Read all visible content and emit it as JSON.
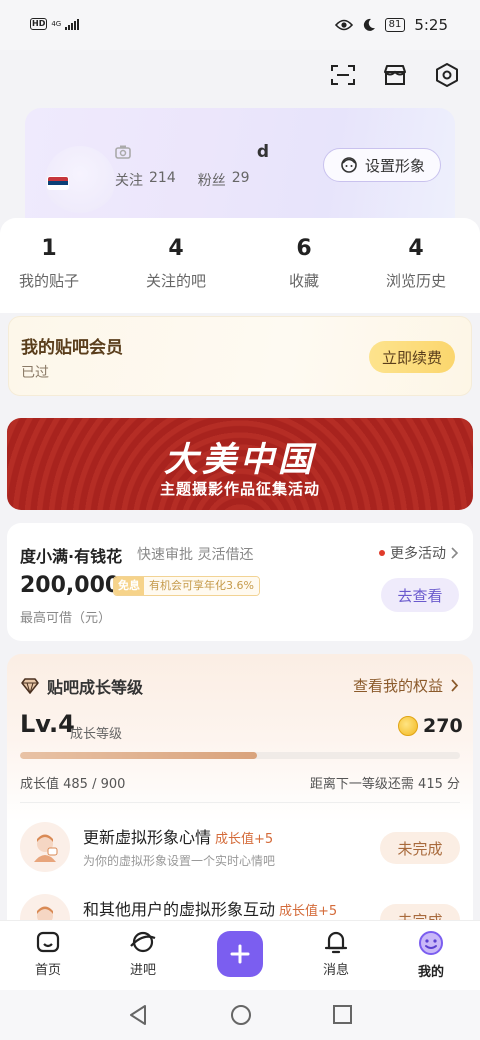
{
  "status_bar": {
    "network_badge": "HD",
    "network_type": "4G",
    "battery": "81",
    "time": "5:25"
  },
  "top_icons": [
    "scan-icon",
    "shop-icon",
    "settings-hexagon-icon"
  ],
  "profile": {
    "username_visible": "d",
    "follow_label": "关注",
    "follow_count": "214",
    "fans_label": "粉丝",
    "fans_count": "29",
    "set_avatar_label": "设置形象"
  },
  "stats": [
    {
      "value": "1",
      "label": "我的贴子"
    },
    {
      "value": "4",
      "label": "关注的吧"
    },
    {
      "value": "6",
      "label": "收藏"
    },
    {
      "value": "4",
      "label": "浏览历史"
    }
  ],
  "membership": {
    "title": "我的贴吧会员",
    "status": "已过",
    "renew_label": "立即续费"
  },
  "banner": {
    "title": "大美中国",
    "subtitle": "主题摄影作品征集活动"
  },
  "loan": {
    "name": "度小满·有钱花",
    "slogan": "快速审批 灵活借还",
    "more_label": "更多活动",
    "amount": "200,000",
    "badge_tag": "免息",
    "badge_text": "有机会可享年化3.6%",
    "limit_label": "最高可借（元）",
    "check_label": "去查看"
  },
  "growth": {
    "title": "贴吧成长等级",
    "rights_label": "查看我的权益",
    "level": "Lv.4",
    "level_label": "成长等级",
    "coins": "270",
    "progress": 0.539,
    "value_text": "成长值 485 / 900",
    "next_text": "距离下一等级还需 415 分",
    "tasks": [
      {
        "title": "更新虚拟形象心情",
        "reward": "成长值+5",
        "desc": "为你的虚拟形象设置一个实时心情吧",
        "button": "未完成"
      },
      {
        "title": "和其他用户的虚拟形象互动",
        "reward": "成长值+5",
        "desc": "",
        "button": "未完成"
      }
    ]
  },
  "bottom_nav": [
    {
      "label": "首页",
      "icon": "home-icon"
    },
    {
      "label": "进吧",
      "icon": "planet-icon"
    },
    {
      "label": "",
      "icon": "plus-icon"
    },
    {
      "label": "消息",
      "icon": "bell-icon"
    },
    {
      "label": "我的",
      "icon": "smile-icon",
      "active": true
    }
  ],
  "colors": {
    "accent": "#7b5ef0",
    "banner_red": "#a8231e",
    "gold_button": "#fbd66d",
    "reward_orange": "#d46b3a"
  }
}
